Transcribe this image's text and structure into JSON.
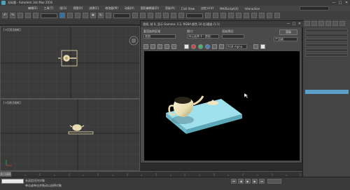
{
  "app": {
    "title": "无标题 - Autodesk 3ds Max 2016",
    "window_controls": [
      "—",
      "□",
      "✕"
    ]
  },
  "menu": {
    "items": [
      "编辑(E)",
      "工具(T)",
      "组(G)",
      "视图(V)",
      "创建(C)",
      "修改器(M)",
      "动画(A)",
      "图形编辑器(D)",
      "渲染(R)",
      "Civil View",
      "自定义(U)",
      "MAXScript(X)",
      "Interaction"
    ]
  },
  "viewports": {
    "top_label": "[+][顶][线框]",
    "front_label": "[+][前][线框]"
  },
  "render_window": {
    "title": "透视, 帧 0, 显示 Gamma: 2.2, RGBA 颜色 16 位/通道 (1:1)",
    "area_label": "要渲染的区域",
    "area_value": "视图",
    "viewport_label": "视口:",
    "viewport_value": "四元菜单 4 - 透视",
    "preset_label": "渲染预设:",
    "preset_value": "",
    "render_button": "渲染",
    "product_label": "产品级",
    "channel_value": "RGB Alpha"
  },
  "status": {
    "selection": "未选定任何对象",
    "hint": "单击或单击并拖动以选择对象",
    "frame": "0 / 100"
  },
  "colors": {
    "teapot": "#e8dcb0",
    "box": "#7fd0e0",
    "render_bg": "#000000",
    "accent": "#2d6fa8"
  }
}
